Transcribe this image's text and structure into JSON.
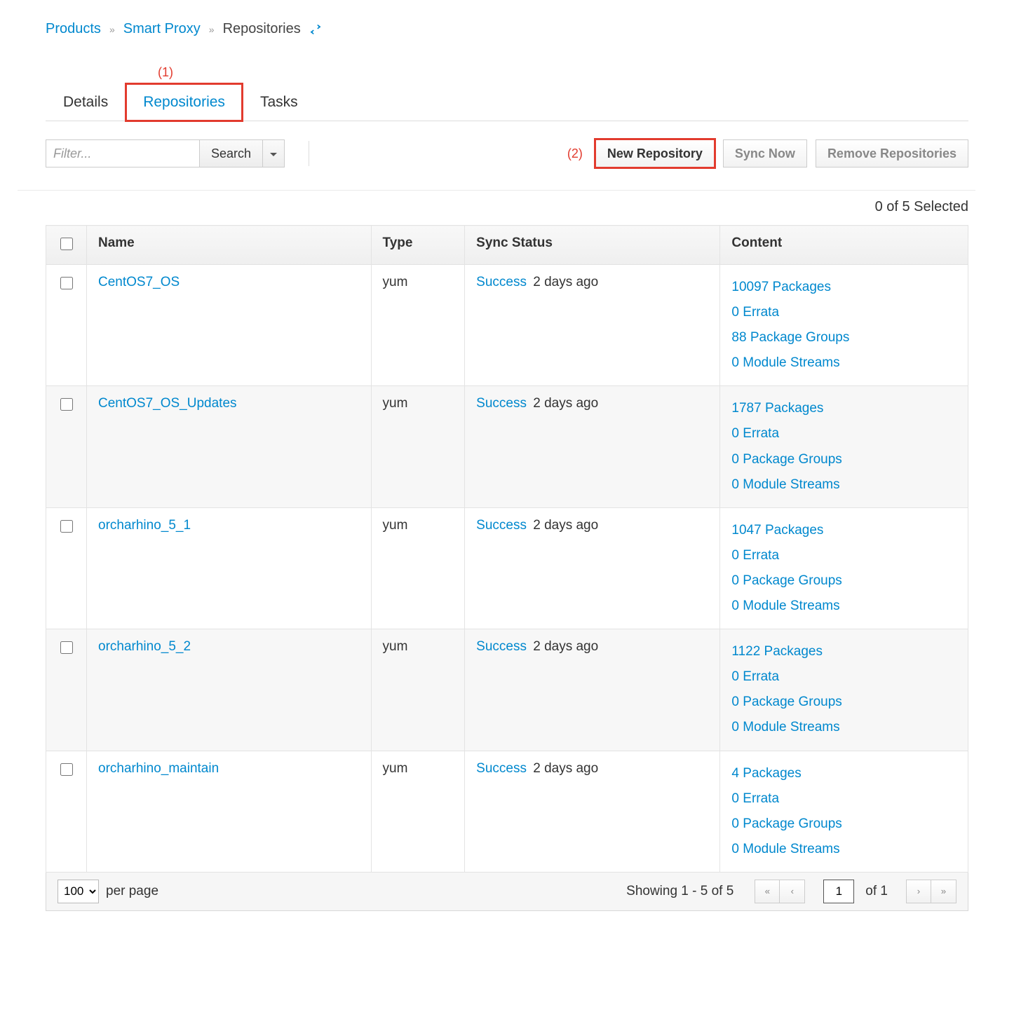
{
  "breadcrumb": {
    "products": "Products",
    "product": "Smart Proxy",
    "current": "Repositories"
  },
  "callouts": {
    "one": "(1)",
    "two": "(2)"
  },
  "tabs": {
    "details": "Details",
    "repositories": "Repositories",
    "tasks": "Tasks"
  },
  "toolbar": {
    "filter_placeholder": "Filter...",
    "search": "Search",
    "new_repo": "New Repository",
    "sync_now": "Sync Now",
    "remove": "Remove Repositories"
  },
  "selection_text": "0 of 5 Selected",
  "columns": {
    "name": "Name",
    "type": "Type",
    "sync": "Sync Status",
    "content": "Content"
  },
  "rows": [
    {
      "name": "CentOS7_OS",
      "type": "yum",
      "sync_status": "Success",
      "sync_age": "2 days ago",
      "content": [
        "10097 Packages",
        "0 Errata",
        "88 Package Groups",
        "0 Module Streams"
      ]
    },
    {
      "name": "CentOS7_OS_Updates",
      "type": "yum",
      "sync_status": "Success",
      "sync_age": "2 days ago",
      "content": [
        "1787 Packages",
        "0 Errata",
        "0 Package Groups",
        "0 Module Streams"
      ]
    },
    {
      "name": "orcharhino_5_1",
      "type": "yum",
      "sync_status": "Success",
      "sync_age": "2 days ago",
      "content": [
        "1047 Packages",
        "0 Errata",
        "0 Package Groups",
        "0 Module Streams"
      ]
    },
    {
      "name": "orcharhino_5_2",
      "type": "yum",
      "sync_status": "Success",
      "sync_age": "2 days ago",
      "content": [
        "1122 Packages",
        "0 Errata",
        "0 Package Groups",
        "0 Module Streams"
      ]
    },
    {
      "name": "orcharhino_maintain",
      "type": "yum",
      "sync_status": "Success",
      "sync_age": "2 days ago",
      "content": [
        "4 Packages",
        "0 Errata",
        "0 Package Groups",
        "0 Module Streams"
      ]
    }
  ],
  "pager": {
    "per_page_value": "100",
    "per_page_label": "per page",
    "showing": "Showing 1 - 5 of 5",
    "page_value": "1",
    "of_pages": "of 1"
  }
}
